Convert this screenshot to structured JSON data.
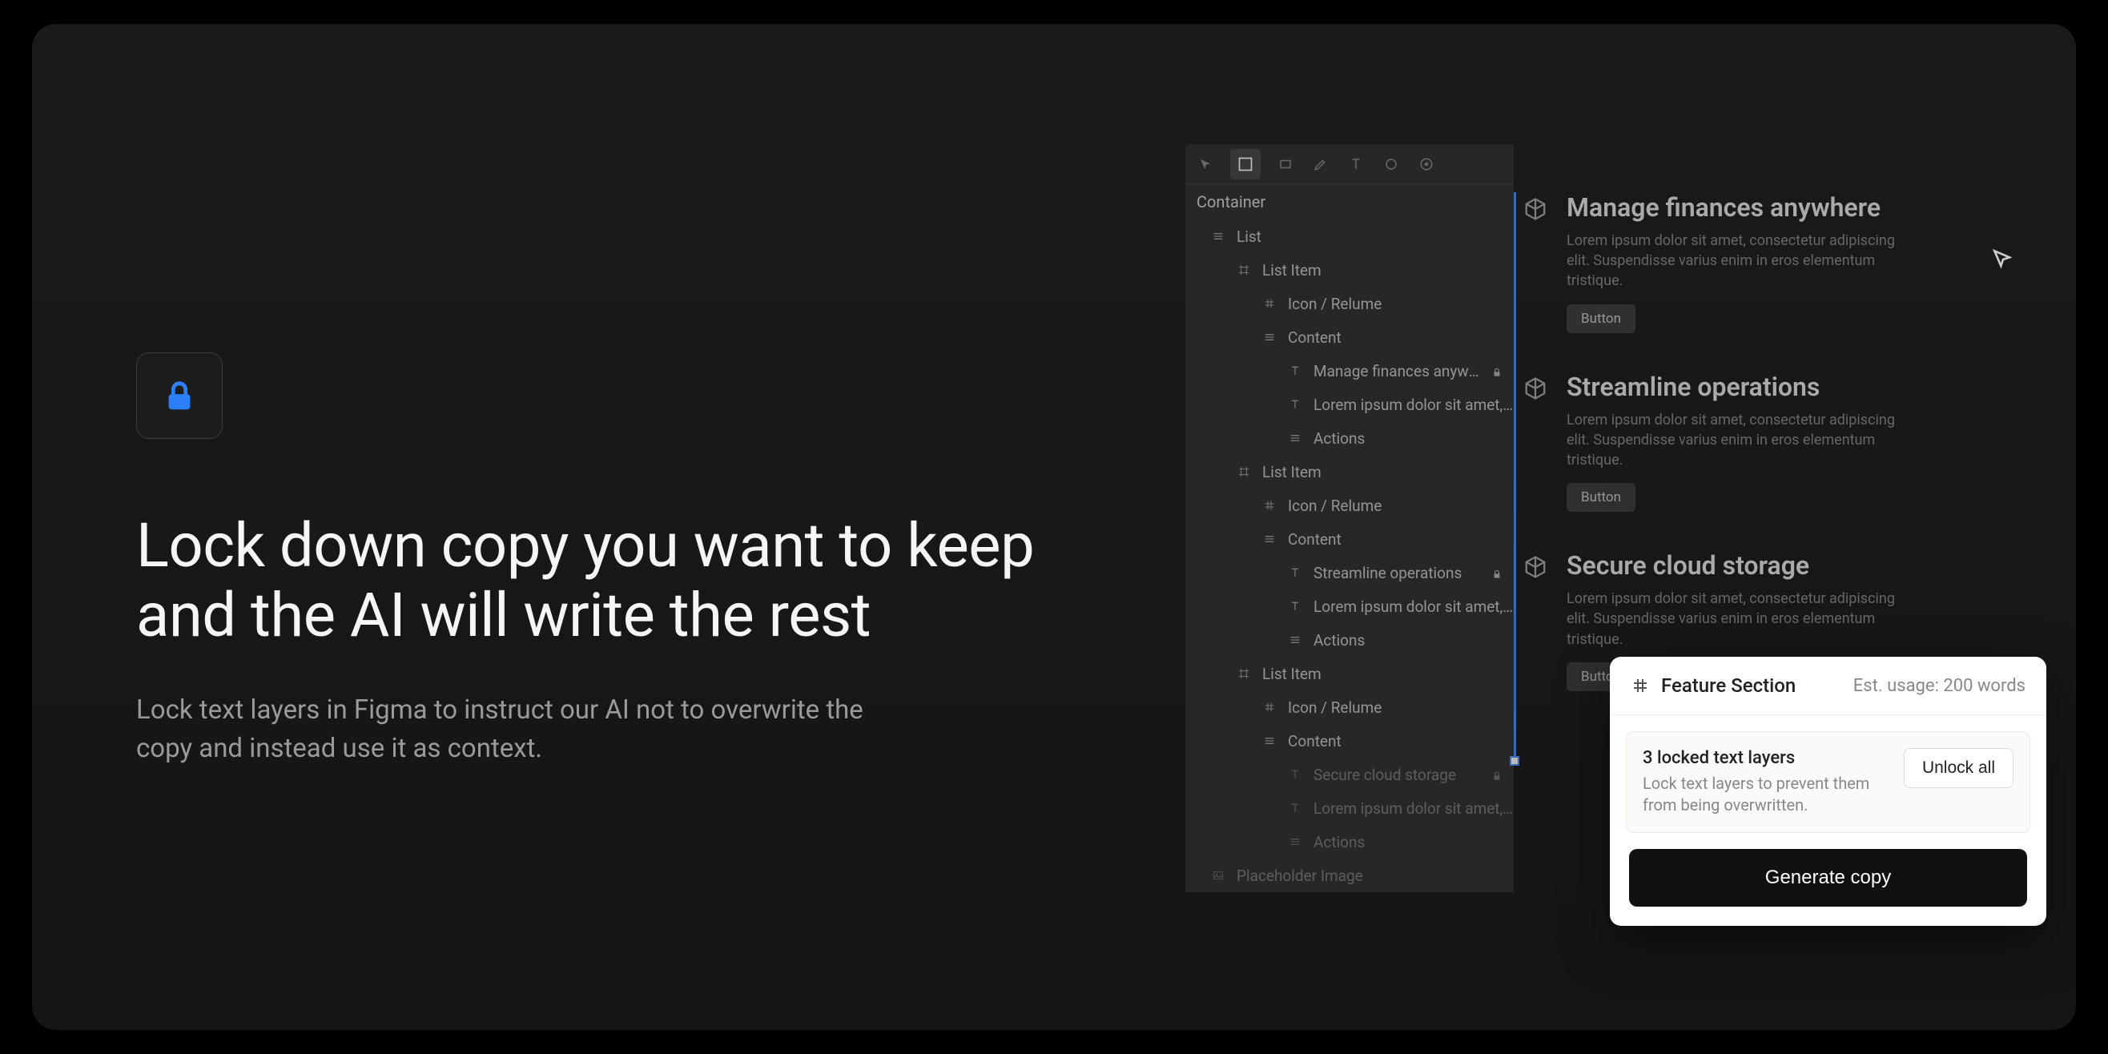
{
  "hero": {
    "headline": "Lock down copy you want to keep and the AI will write the rest",
    "subhead": "Lock text layers in Figma to instruct our AI not to overwrite the copy and instead use it as context."
  },
  "figma": {
    "container": "Container",
    "layers": [
      {
        "depth": 1,
        "icon": "list",
        "label": "List"
      },
      {
        "depth": 2,
        "icon": "frame",
        "label": "List Item"
      },
      {
        "depth": 3,
        "icon": "hash",
        "label": "Icon / Relume"
      },
      {
        "depth": 3,
        "icon": "list",
        "label": "Content"
      },
      {
        "depth": 4,
        "icon": "text",
        "label": "Manage finances anywhere",
        "locked": true
      },
      {
        "depth": 4,
        "icon": "text",
        "label": "Lorem ipsum dolor sit amet, conse..."
      },
      {
        "depth": 4,
        "icon": "list",
        "label": "Actions"
      },
      {
        "depth": 2,
        "icon": "frame",
        "label": "List Item"
      },
      {
        "depth": 3,
        "icon": "hash",
        "label": "Icon / Relume"
      },
      {
        "depth": 3,
        "icon": "list",
        "label": "Content"
      },
      {
        "depth": 4,
        "icon": "text",
        "label": "Streamline operations",
        "locked": true
      },
      {
        "depth": 4,
        "icon": "text",
        "label": "Lorem ipsum dolor sit amet, conse..."
      },
      {
        "depth": 4,
        "icon": "list",
        "label": "Actions"
      },
      {
        "depth": 2,
        "icon": "frame",
        "label": "List Item"
      },
      {
        "depth": 3,
        "icon": "hash",
        "label": "Icon / Relume"
      },
      {
        "depth": 3,
        "icon": "list",
        "label": "Content"
      },
      {
        "depth": 4,
        "icon": "text",
        "label": "Secure cloud storage",
        "locked": true,
        "dim": true
      },
      {
        "depth": 4,
        "icon": "text",
        "label": "Lorem ipsum dolor sit amet, conse...",
        "dim": true
      },
      {
        "depth": 4,
        "icon": "list",
        "label": "Actions",
        "dim": true
      },
      {
        "depth": 1,
        "icon": "image",
        "label": "Placeholder Image",
        "dim": true
      }
    ]
  },
  "cards": [
    {
      "title": "Manage finances anywhere",
      "desc": "Lorem ipsum dolor sit amet, consectetur adipiscing elit. Suspendisse varius enim in eros elementum tristique.",
      "btn": "Button"
    },
    {
      "title": "Streamline operations",
      "desc": "Lorem ipsum dolor sit amet, consectetur adipiscing elit. Suspendisse varius enim in eros elementum tristique.",
      "btn": "Button"
    },
    {
      "title": "Secure cloud storage",
      "desc": "Lorem ipsum dolor sit amet, consectetur adipiscing elit. Suspendisse varius enim in eros elementum tristique.",
      "btn": "Button"
    }
  ],
  "popup": {
    "section": "Feature Section",
    "usage": "Est. usage: 200 words",
    "locked_title": "3 locked text layers",
    "locked_desc": "Lock text layers to prevent them from being overwritten.",
    "unlock": "Unlock all",
    "generate": "Generate copy"
  }
}
